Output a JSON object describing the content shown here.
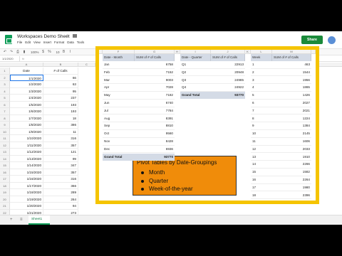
{
  "app": {
    "doc_title": "Workspaces Demo Sheet",
    "menu": [
      "File",
      "Edit",
      "View",
      "Insert",
      "Format",
      "Data",
      "Tools"
    ],
    "share_label": "Share",
    "zoom": "100%",
    "font_size_label": "10",
    "name_box": "1/1/2020",
    "sheet_tab": "Sheet1"
  },
  "main_sheet": {
    "headers": [
      "Date",
      "# of Calls"
    ],
    "rows": [
      [
        "1/1/2020",
        "66"
      ],
      [
        "1/2/2020",
        "63"
      ],
      [
        "1/3/2020",
        "95"
      ],
      [
        "1/4/2020",
        "237"
      ],
      [
        "1/5/2020",
        "193"
      ],
      [
        "1/6/2020",
        "193"
      ],
      [
        "1/7/2020",
        "18"
      ],
      [
        "1/8/2020",
        "386"
      ],
      [
        "1/9/2020",
        "11"
      ],
      [
        "1/10/2020",
        "316"
      ],
      [
        "1/11/2020",
        "357"
      ],
      [
        "1/12/2020",
        "121"
      ],
      [
        "1/13/2020",
        "99"
      ],
      [
        "1/14/2020",
        "347"
      ],
      [
        "1/15/2020",
        "357"
      ],
      [
        "1/16/2020",
        "316"
      ],
      [
        "1/17/2020",
        "366"
      ],
      [
        "1/18/2020",
        "289"
      ],
      [
        "1/19/2020",
        "264"
      ],
      [
        "1/20/2020",
        "94"
      ],
      [
        "1/21/2020",
        "273"
      ]
    ]
  },
  "pivot_month": {
    "header": [
      "Date - Month",
      "SUM of # of Calls"
    ],
    "rows": [
      [
        "Jan",
        "6758"
      ],
      [
        "Feb",
        "7152"
      ],
      [
        "Mar",
        "9003"
      ],
      [
        "Apr",
        "7028"
      ],
      [
        "May",
        "7182"
      ],
      [
        "Jun",
        "6740"
      ],
      [
        "Jul",
        "7784"
      ],
      [
        "Aug",
        "8391"
      ],
      [
        "Sep",
        "8810"
      ],
      [
        "Oct",
        "9560"
      ],
      [
        "Nov",
        "8428"
      ],
      [
        "Dec",
        "6936"
      ]
    ],
    "total": [
      "Grand Total",
      "93770"
    ]
  },
  "pivot_quarter": {
    "header": [
      "Date - Quarter",
      "SUM of # of Calls"
    ],
    "rows": [
      [
        "Q1",
        "22913"
      ],
      [
        "Q2",
        "20948"
      ],
      [
        "Q3",
        "24985"
      ],
      [
        "Q4",
        "24922"
      ]
    ],
    "total": [
      "Grand Total",
      "93770"
    ]
  },
  "pivot_week": {
    "header": [
      "Week",
      "SUM of # of Calls"
    ],
    "rows": [
      [
        "1",
        "463"
      ],
      [
        "2",
        "1544"
      ],
      [
        "3",
        "1956"
      ],
      [
        "4",
        "1865"
      ],
      [
        "5",
        "1426"
      ],
      [
        "6",
        "2027"
      ],
      [
        "7",
        "2021"
      ],
      [
        "8",
        "1224"
      ],
      [
        "9",
        "1384"
      ],
      [
        "10",
        "2145"
      ],
      [
        "11",
        "1606"
      ],
      [
        "12",
        "2033"
      ],
      [
        "13",
        "1910"
      ],
      [
        "14",
        "2266"
      ],
      [
        "15",
        "1582"
      ],
      [
        "16",
        "2264"
      ],
      [
        "17",
        "1980"
      ],
      [
        "18",
        "2396"
      ],
      [
        "19",
        "1807"
      ],
      [
        "20",
        "1108"
      ]
    ]
  },
  "callout": {
    "title": "Pivot Tables by Date-Groupings",
    "items": [
      "Month",
      "Quarter",
      "Week-of-the-year"
    ]
  },
  "colors": {
    "highlight_border": "#f5c400",
    "callout_bg": "#f08c0a",
    "pivot_header": "#d4dbe6",
    "sheets_green": "#0f9d58"
  }
}
